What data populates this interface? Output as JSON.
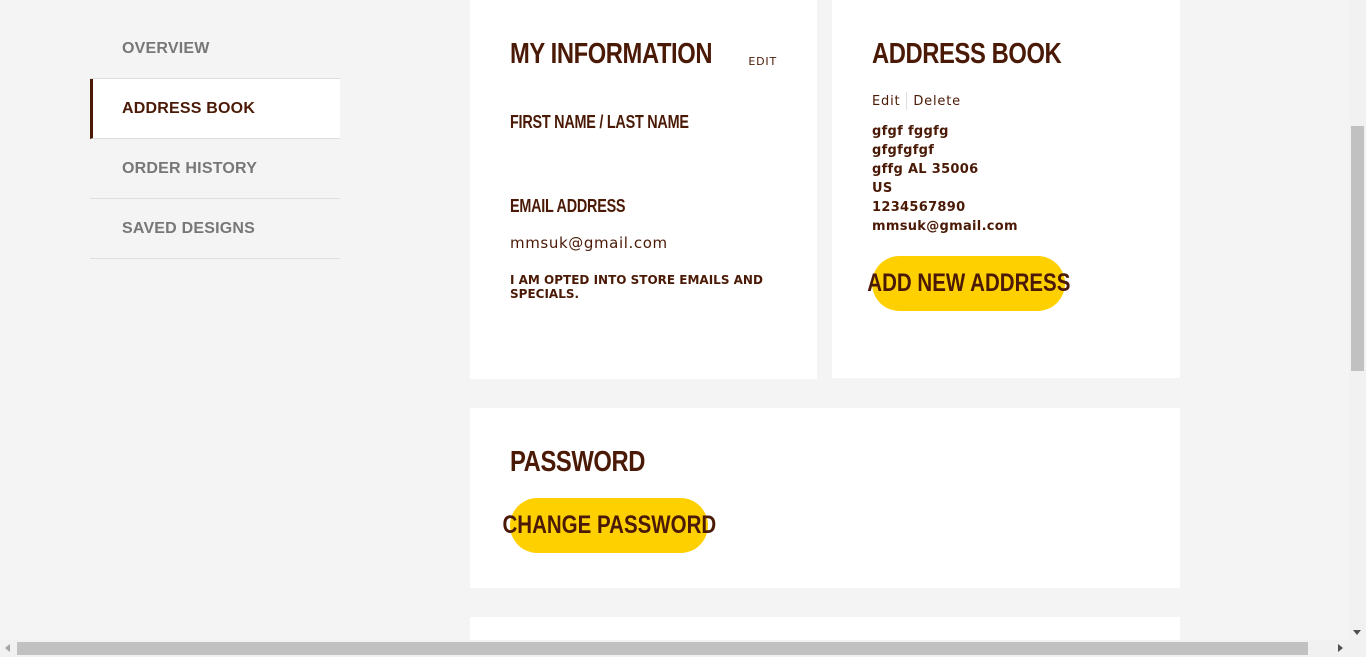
{
  "sidebar": {
    "items": [
      {
        "label": "OVERVIEW"
      },
      {
        "label": "ADDRESS BOOK"
      },
      {
        "label": "ORDER HISTORY"
      },
      {
        "label": "SAVED DESIGNS"
      }
    ],
    "active": "ADDRESS BOOK"
  },
  "my_information": {
    "title": "MY INFORMATION",
    "edit_label": "EDIT",
    "name_label": "FIRST NAME / LAST NAME",
    "email_label": "EMAIL ADDRESS",
    "email_value": "mmsuk@gmail.com",
    "optin_text": "I AM OPTED INTO STORE EMAILS AND SPECIALS."
  },
  "address_book": {
    "title": "ADDRESS BOOK",
    "edit_label": "Edit",
    "delete_label": "Delete",
    "lines": [
      "gfgf fggfg",
      "gfgfgfgf",
      "gffg AL 35006",
      "US",
      "1234567890",
      "mmsuk@gmail.com"
    ],
    "add_button": "ADD NEW ADDRESS"
  },
  "password": {
    "title": "PASSWORD",
    "change_button": "CHANGE PASSWORD"
  },
  "colors": {
    "accent_yellow": "#ffd000",
    "brand_brown": "#4a1a06",
    "background": "#f4f4f4"
  }
}
